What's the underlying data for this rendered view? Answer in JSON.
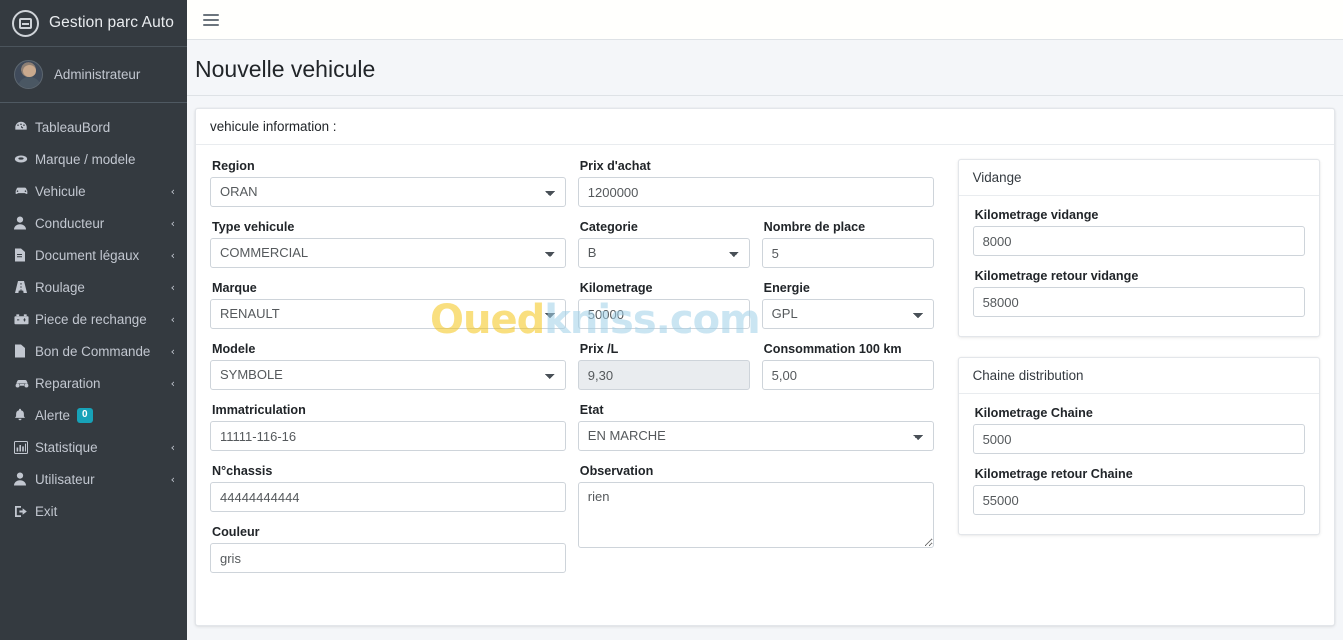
{
  "sidebar": {
    "brand": {
      "title": "Gestion parc Auto",
      "logo_icon": "logo-circle-icon"
    },
    "user": {
      "name": "Administrateur",
      "avatar_icon": "avatar"
    },
    "items": [
      {
        "label": "TableauBord",
        "icon": "dashboard-icon",
        "arrow": ""
      },
      {
        "label": "Marque / modele",
        "icon": "tag-icon",
        "arrow": ""
      },
      {
        "label": "Vehicule",
        "icon": "car-icon",
        "arrow": "‹"
      },
      {
        "label": "Conducteur",
        "icon": "user-icon",
        "arrow": "‹"
      },
      {
        "label": "Document légaux",
        "icon": "file-icon",
        "arrow": "‹"
      },
      {
        "label": "Roulage",
        "icon": "road-icon",
        "arrow": "‹"
      },
      {
        "label": "Piece de rechange",
        "icon": "battery-icon",
        "arrow": "‹"
      },
      {
        "label": "Bon de Commande",
        "icon": "document-icon",
        "arrow": "‹"
      },
      {
        "label": "Reparation",
        "icon": "car-repair-icon",
        "arrow": "‹"
      },
      {
        "label": "Alerte",
        "icon": "bell-icon",
        "arrow": "",
        "badge": "0"
      },
      {
        "label": "Statistique",
        "icon": "chart-icon",
        "arrow": "‹"
      },
      {
        "label": "Utilisateur",
        "icon": "user-icon",
        "arrow": "‹"
      },
      {
        "label": "Exit",
        "icon": "logout-icon",
        "arrow": ""
      }
    ]
  },
  "topbar": {
    "menu_icon": "hamburger-icon"
  },
  "page": {
    "title": "Nouvelle vehicule"
  },
  "card": {
    "header": "vehicule information :"
  },
  "form": {
    "region": {
      "label": "Region",
      "value": "ORAN"
    },
    "type_vehicule": {
      "label": "Type vehicule",
      "value": "COMMERCIAL"
    },
    "marque": {
      "label": "Marque",
      "value": "RENAULT"
    },
    "modele": {
      "label": "Modele",
      "value": "SYMBOLE"
    },
    "immatriculation": {
      "label": "Immatriculation",
      "value": "11111-116-16"
    },
    "chassis": {
      "label": "N°chassis",
      "value": "44444444444"
    },
    "couleur": {
      "label": "Couleur",
      "value": "gris"
    },
    "prix_achat": {
      "label": "Prix d'achat",
      "value": "1200000"
    },
    "categorie": {
      "label": "Categorie",
      "value": "B"
    },
    "nombre_place": {
      "label": "Nombre de place",
      "value": "5"
    },
    "kilometrage": {
      "label": "Kilometrage",
      "value": "50000"
    },
    "energie": {
      "label": "Energie",
      "value": "GPL"
    },
    "prix_l": {
      "label": "Prix /L",
      "value": "9,30"
    },
    "consommation": {
      "label": "Consommation 100 km",
      "value": "5,00"
    },
    "etat": {
      "label": "Etat",
      "value": "EN MARCHE"
    },
    "observation": {
      "label": "Observation",
      "value": "rien"
    }
  },
  "vidange": {
    "header": "Vidange",
    "kilometrage": {
      "label": "Kilometrage vidange",
      "value": "8000"
    },
    "kilometrage_retour": {
      "label": "Kilometrage retour vidange",
      "value": "58000"
    }
  },
  "chaine": {
    "header": "Chaine distribution",
    "kilometrage": {
      "label": "Kilometrage Chaine",
      "value": "5000"
    },
    "kilometrage_retour": {
      "label": "Kilometrage retour Chaine",
      "value": "55000"
    }
  },
  "watermark": {
    "part1": "Oued",
    "part2": "kniss.com"
  },
  "colors": {
    "sidebar_bg": "#343a40",
    "badge": "#17a2b8",
    "page_bg": "#f4f6f9",
    "watermark_gold": "#f5c518",
    "watermark_blue": "#9fd0e8"
  }
}
